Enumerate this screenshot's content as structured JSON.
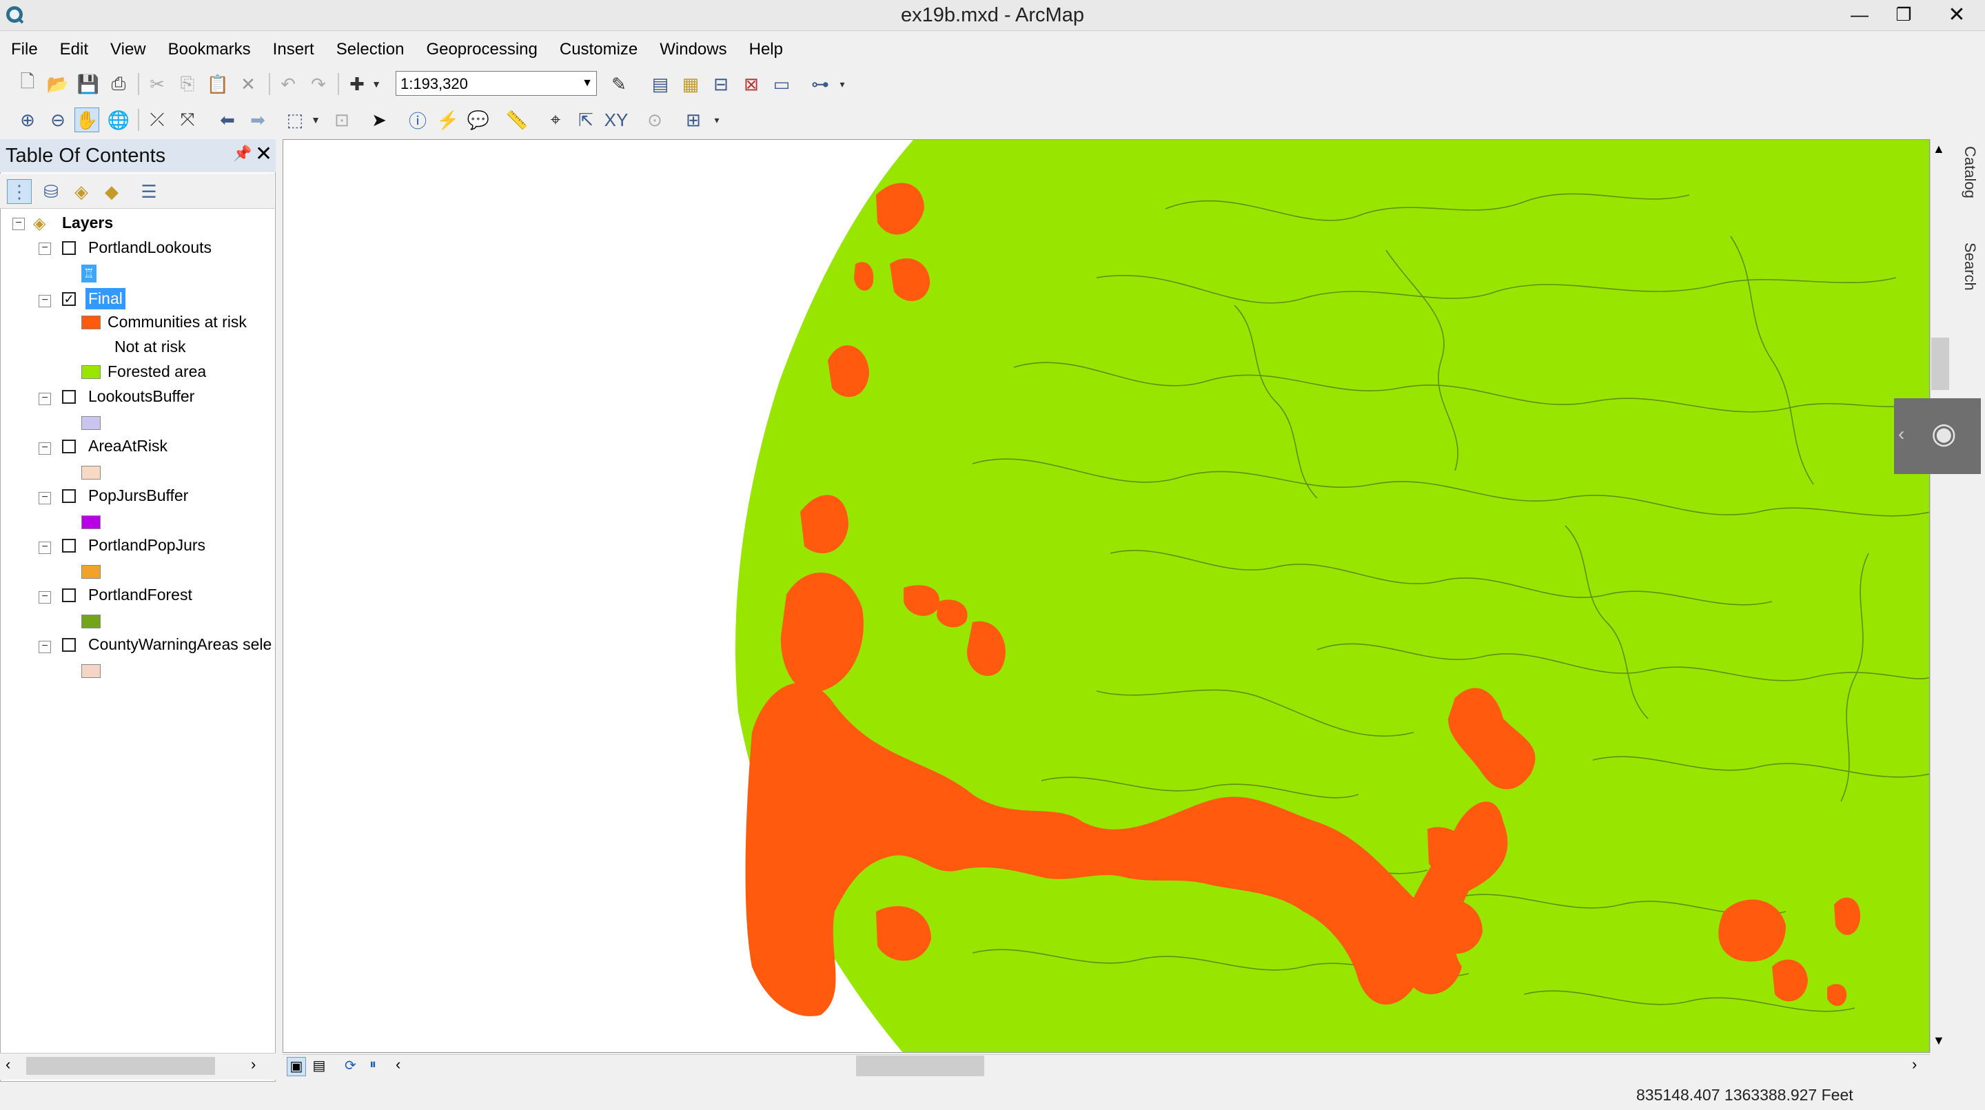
{
  "window": {
    "title": "ex19b.mxd - ArcMap",
    "minimize": "—",
    "restore": "❐",
    "close": "✕"
  },
  "menus": [
    "File",
    "Edit",
    "View",
    "Bookmarks",
    "Insert",
    "Selection",
    "Geoprocessing",
    "Customize",
    "Windows",
    "Help"
  ],
  "toolbar": {
    "scale_value": "1:193,320"
  },
  "toc": {
    "title": "Table Of Contents",
    "pin_icon": "pin-icon",
    "close_icon": "close-icon",
    "root_label": "Layers",
    "layers": [
      {
        "name": "PortlandLookouts",
        "checked": false
      },
      {
        "name": "Final",
        "checked": true,
        "selected": true
      },
      {
        "name": "LookoutsBuffer",
        "checked": false
      },
      {
        "name": "AreaAtRisk",
        "checked": false
      },
      {
        "name": "PopJursBuffer",
        "checked": false
      },
      {
        "name": "PortlandPopJurs",
        "checked": false
      },
      {
        "name": "PortlandForest",
        "checked": false
      },
      {
        "name": "CountyWarningAreas sele",
        "checked": false
      }
    ],
    "final_legend": [
      {
        "label": "Communities at risk",
        "color": "#ff5a0e"
      },
      {
        "label": "Not at risk",
        "color": null
      },
      {
        "label": "Forested area",
        "color": "#98e600"
      }
    ],
    "swatch_colors": {
      "LookoutsBuffer": "#c9c5ee",
      "AreaAtRisk": "#f7d9c4",
      "PopJursBuffer": "#b800e6",
      "PortlandPopJurs": "#f2a12b",
      "PortlandForest": "#74a417",
      "CountyWarningAreas": "#f5d6c6"
    }
  },
  "right_tabs": [
    "Catalog",
    "Search"
  ],
  "status": {
    "coordinates": "835148.407  1363388.927 Feet"
  },
  "colors": {
    "forest": "#98e600",
    "risk": "#ff5a0e",
    "contour": "#5f8f10"
  }
}
